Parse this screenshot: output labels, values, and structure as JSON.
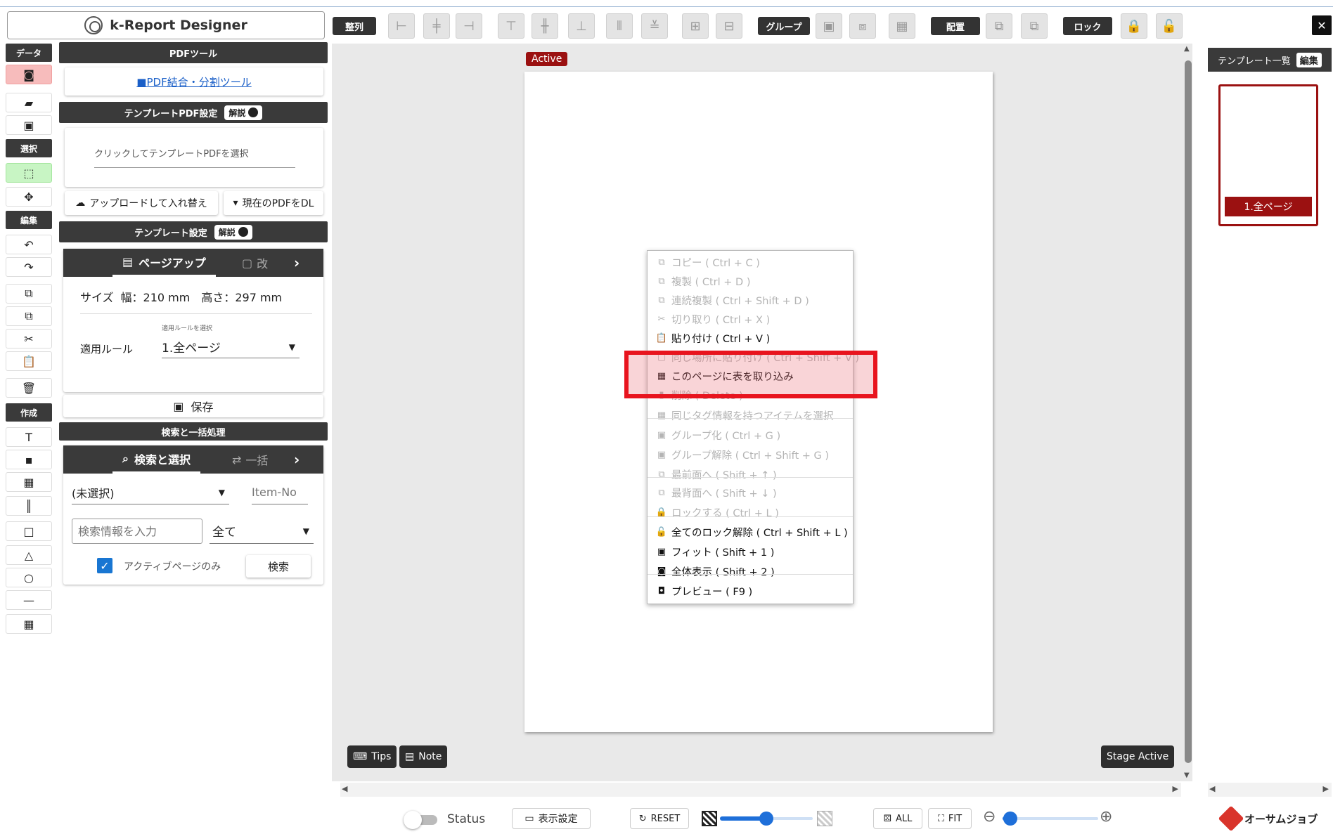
{
  "app": {
    "title": "k-Report Designer"
  },
  "toolbar": {
    "align_label": "整列",
    "group_label": "グループ",
    "arrange_label": "配置",
    "lock_label": "ロック",
    "close": "✕"
  },
  "left_column": {
    "data_label": "データ",
    "select_label": "選択",
    "edit_label": "編集",
    "create_label": "作成"
  },
  "pdf_tools": {
    "header": "PDFツール",
    "link": "■PDF結合・分割ツール"
  },
  "template_pdf": {
    "header": "テンプレートPDF設定",
    "help": "解説",
    "placeholder": "クリックしてテンプレートPDFを選択",
    "upload_button": "アップロードして入れ替え",
    "download_button": "現在のPDFをDL"
  },
  "template_settings": {
    "header": "テンプレート設定",
    "help": "解説",
    "tab_active": "ページアップ",
    "tab_other": "改",
    "size_label": "サイズ",
    "size_value": "幅：210 mm　高さ：297 mm",
    "rule_caption": "適用ルールを選択",
    "rule_label": "適用ルール",
    "rule_value": "1.全ページ",
    "save_button": "保存"
  },
  "search": {
    "header": "検索と一括処理",
    "tab_active": "検索と選択",
    "tab_other": "一括",
    "select_value": "(未選択)",
    "item_no_placeholder": "Item-No",
    "input_placeholder": "検索情報を入力",
    "scope_value": "全て",
    "checkbox_label": "アクティブページのみ",
    "search_button": "検索"
  },
  "stage": {
    "active_badge": "Active",
    "tips": "Tips",
    "note": "Note",
    "stage_active": "Stage Active"
  },
  "context_menu": {
    "items": [
      {
        "label": "コピー ( Ctrl + C )",
        "icon": "copy-icon",
        "glyph": "⧉",
        "enabled": false
      },
      {
        "label": "複製 ( Ctrl + D )",
        "icon": "duplicate-icon",
        "glyph": "⧉",
        "enabled": false
      },
      {
        "label": "連続複製 ( Ctrl + Shift + D )",
        "icon": "multi-duplicate-icon",
        "glyph": "⧉",
        "enabled": false
      },
      {
        "label": "切り取り ( Ctrl + X )",
        "icon": "scissors-icon",
        "glyph": "✂",
        "enabled": false
      },
      {
        "label": "貼り付け ( Ctrl + V )",
        "icon": "clipboard-icon",
        "glyph": "📋",
        "enabled": true
      },
      {
        "label": "同じ場所に貼り付け ( Ctrl + Shift + V )",
        "icon": "clipboard-icon",
        "glyph": "▢",
        "enabled": false
      },
      {
        "label": "このページに表を取り込み",
        "icon": "table-import-icon",
        "glyph": "▦",
        "enabled": true
      },
      {
        "label": "削除 ( Delete )",
        "icon": "trash-icon",
        "glyph": "▮",
        "enabled": false
      },
      {
        "label": "同じタグ情報を持つアイテムを選択",
        "icon": "tag-select-icon",
        "glyph": "▦",
        "enabled": false
      },
      {
        "label": "グループ化 ( Ctrl + G )",
        "icon": "group-icon",
        "glyph": "▣",
        "enabled": false
      },
      {
        "label": "グループ解除 ( Ctrl + Shift + G )",
        "icon": "ungroup-icon",
        "glyph": "▣",
        "enabled": false
      },
      {
        "label": "最前面へ ( Shift + ↑ )",
        "icon": "bring-front-icon",
        "glyph": "⧉",
        "enabled": false
      },
      {
        "label": "最背面へ ( Shift + ↓ )",
        "icon": "send-back-icon",
        "glyph": "⧉",
        "enabled": false
      },
      {
        "label": "ロックする ( Ctrl + L )",
        "icon": "lock-icon",
        "glyph": "🔒",
        "enabled": false
      },
      {
        "label": "全てのロック解除 ( Ctrl + Shift + L )",
        "icon": "unlock-icon",
        "glyph": "🔓",
        "enabled": true
      },
      {
        "label": "フィット ( Shift + 1 )",
        "icon": "fit-icon",
        "glyph": "▣",
        "enabled": true
      },
      {
        "label": "全体表示 ( Shift + 2 )",
        "icon": "show-all-icon",
        "glyph": "◙",
        "enabled": true
      },
      {
        "label": "プレビュー ( F9 )",
        "icon": "preview-icon",
        "glyph": "◘",
        "enabled": true
      }
    ]
  },
  "template_list": {
    "header": "テンプレート一覧",
    "edit": "編集",
    "page_label": "1.全ページ"
  },
  "bottom_bar": {
    "status_label": "Status",
    "display_settings": "表示設定",
    "reset": "RESET",
    "all": "ALL",
    "fit": "FIT",
    "opacity_fraction": 0.5,
    "zoom_fraction": 0.08,
    "brand": "オーサムジョブ"
  },
  "colors": {
    "accent": "#9b1111",
    "highlight": "#e8141e",
    "header_bg": "#3a3a3a"
  }
}
